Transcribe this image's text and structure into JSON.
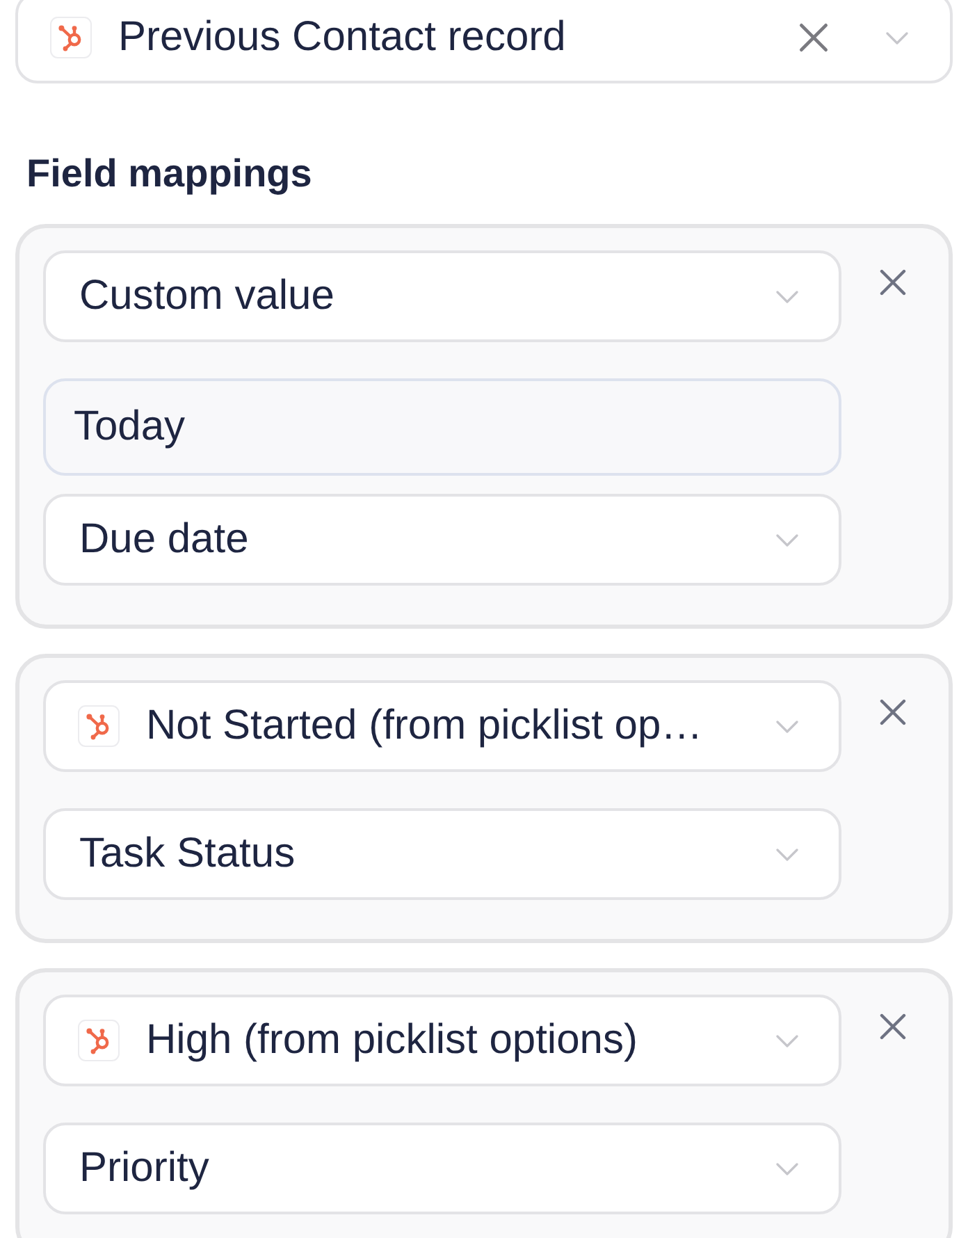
{
  "record_select": {
    "value": "Previous Contact record",
    "logo": true
  },
  "section_title": "Field mappings",
  "mappings": [
    {
      "fields": [
        {
          "kind": "select",
          "value": "Custom value",
          "logo": false
        },
        {
          "kind": "input",
          "value": "Today"
        },
        {
          "kind": "select",
          "value": "Due date",
          "logo": false
        }
      ]
    },
    {
      "fields": [
        {
          "kind": "select",
          "value": "Not Started (from picklist op…",
          "logo": true
        },
        {
          "kind": "select",
          "value": "Task Status",
          "logo": false
        }
      ]
    },
    {
      "fields": [
        {
          "kind": "select",
          "value": "High (from picklist options)",
          "logo": true
        },
        {
          "kind": "select",
          "value": "Priority",
          "logo": false
        }
      ]
    }
  ]
}
